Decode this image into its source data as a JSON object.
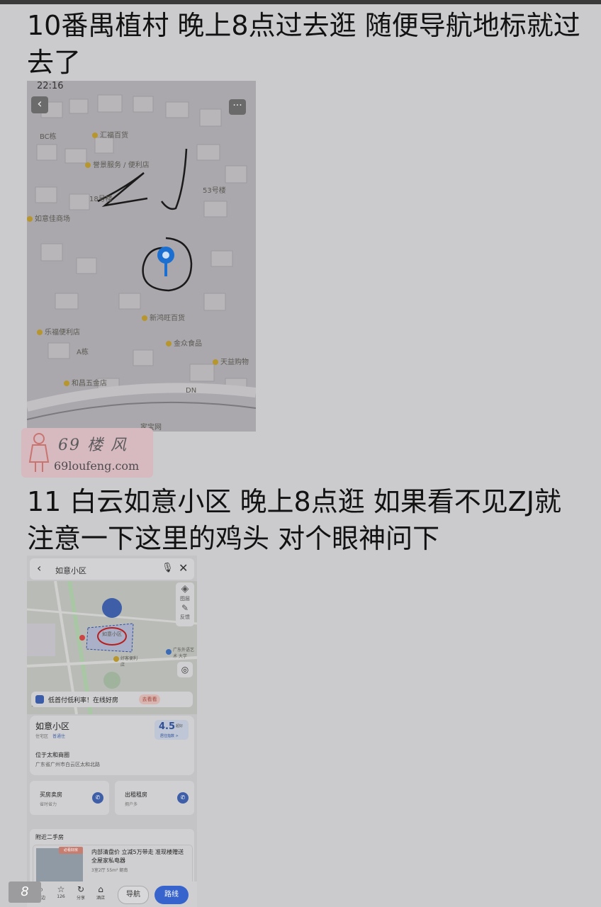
{
  "post": {
    "item10_text": "10番禺植村 晚上8点过去逛 随便导航地标就过去了",
    "item11_text": "11 白云如意小区  晚上8点逛 如果看不见ZJ就注意一下这里的鸡头 对个眼神问下"
  },
  "shot1": {
    "status_time": "22:16",
    "more_glyph": "···",
    "back_glyph": "‹",
    "pois": [
      "BC栋",
      "汇福百货",
      "誉景服务 / 便利店",
      "18号楼",
      "53号楼",
      "如意佳商场",
      "新鸿旺百货",
      "乐福便利店",
      "A栋",
      "金众食品",
      "天益购物",
      "和昌五金店",
      "DN",
      "家宝网"
    ],
    "annotation": "ZJ",
    "pin_color": "#1a6fd1"
  },
  "watermark": {
    "top": "69 楼 风",
    "bottom": "69loufeng.com"
  },
  "shot2": {
    "query": "如意小区",
    "tools": [
      "图层",
      "反馈"
    ],
    "map_labels": [
      "如意小区",
      "广东外语艺术 大学",
      "好客便利 店",
      "100米"
    ],
    "banner_text": "低首付低利率！在线好房",
    "banner_pill": "去看看",
    "place_name": "如意小区",
    "tags": [
      "住宅区",
      "普通住"
    ],
    "score_value": "4.5",
    "score_unit": "超好",
    "score_label": "居住指数 >",
    "area": "位于太和商圈",
    "address": "广东省广州市白云区太和北路",
    "services": [
      {
        "title": "买房卖房",
        "sub": "省时省力"
      },
      {
        "title": "出租租房",
        "sub": "拥户多"
      }
    ],
    "nearby_header": "附近二手房",
    "listing_badge": "必看好房",
    "listing_title": "内部清盘价 立减5万带走 准现楼赠送全屋家私电器",
    "listing_meta": "3室2厅 55m² 朝南",
    "bottom_items": [
      {
        "glyph": "⌕",
        "label": "周边"
      },
      {
        "glyph": "☆",
        "label": "126"
      },
      {
        "glyph": "↻",
        "label": "分享"
      },
      {
        "glyph": "⌂",
        "label": "酒店"
      }
    ],
    "nav_label": "导航",
    "route_label": "路线"
  },
  "page_badge": "8"
}
